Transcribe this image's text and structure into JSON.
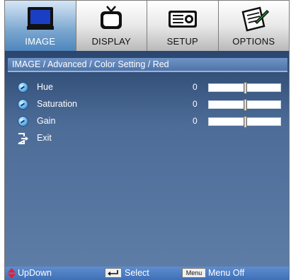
{
  "tabs": [
    {
      "label": "IMAGE",
      "icon": "monitor-icon",
      "active": true
    },
    {
      "label": "DISPLAY",
      "icon": "tv-icon",
      "active": false
    },
    {
      "label": "SETUP",
      "icon": "projector-icon",
      "active": false
    },
    {
      "label": "OPTIONS",
      "icon": "notepad-icon",
      "active": false
    }
  ],
  "breadcrumb": "IMAGE / Advanced / Color Setting / Red",
  "settings": [
    {
      "label": "Hue",
      "value": "0",
      "level": 0.5
    },
    {
      "label": "Saturation",
      "value": "0",
      "level": 0.5
    },
    {
      "label": "Gain",
      "value": "0",
      "level": 0.5
    }
  ],
  "exit_label": "Exit",
  "footer": {
    "updown_label": "UpDown",
    "select_label": "Select",
    "menu_key": "Menu",
    "menu_label": "Menu Off"
  },
  "colors": {
    "active_tab": "#4f86bd",
    "panel": "#4d6d98",
    "footer": "#4f7fc4",
    "updown_arrow": "#e0203a"
  }
}
